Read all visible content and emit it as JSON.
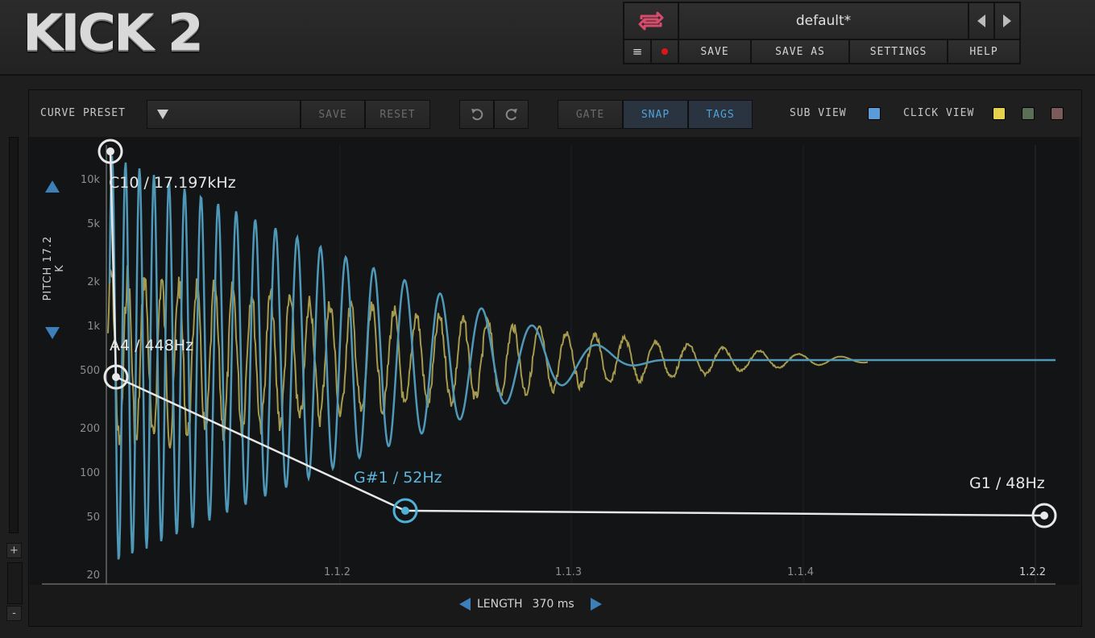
{
  "app": {
    "logo": "KICK 2"
  },
  "preset_bar": {
    "preset_name": "default*",
    "menu_icon": "hamburger-icon",
    "record_icon": "record-dot-icon",
    "save_label": "SAVE",
    "save_as_label": "SAVE AS",
    "settings_label": "SETTINGS",
    "help_label": "HELP",
    "loop_icon": "loop-icon"
  },
  "toolbar": {
    "curve_preset_label": "CURVE PRESET",
    "dropdown_icon": "dropdown-arrow-icon",
    "save_label": "SAVE",
    "reset_label": "RESET",
    "undo_icon": "undo-icon",
    "redo_icon": "redo-icon",
    "gate_label": "GATE",
    "snap_label": "SNAP",
    "tags_label": "TAGS",
    "sub_view_label": "SUB VIEW",
    "click_view_label": "CLICK VIEW",
    "sub_view_color": "#5b9bd8",
    "click_view_colors": [
      "#e6d24a",
      "#5b6e56",
      "#7a5a5a"
    ]
  },
  "graph": {
    "pitch_label": "PITCH 17.2 K",
    "y_ticks": [
      "10k",
      "5k",
      "2k",
      "1k",
      "500",
      "200",
      "100",
      "50",
      "20"
    ],
    "x_ticks": [
      "1.1.2",
      "1.1.3",
      "1.1.4",
      "1.2.2"
    ],
    "nodes": [
      {
        "label": "C10 / 17.197kHz",
        "note": "C10",
        "freq_hz": 17197
      },
      {
        "label": "A4 / 448Hz",
        "note": "A4",
        "freq_hz": 448
      },
      {
        "label": "G#1 / 52Hz",
        "note": "G#1",
        "freq_hz": 52,
        "selected": true
      },
      {
        "label": "G1 / 48Hz",
        "note": "G1",
        "freq_hz": 48
      }
    ],
    "length_label": "LENGTH",
    "length_value": "370 ms",
    "waveform_color": "#4f98b8",
    "click_wave_color": "#a59a4e",
    "curve_color": "#e8e8e8"
  },
  "side_controls": {
    "plus": "+",
    "minus": "-"
  }
}
